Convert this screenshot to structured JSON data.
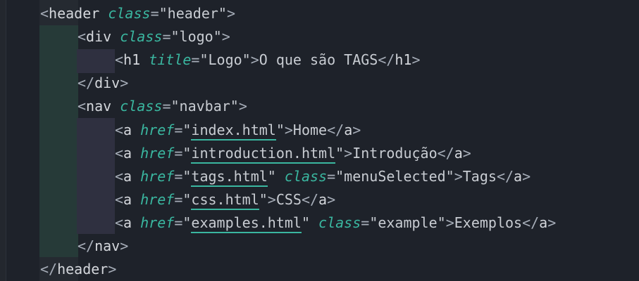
{
  "lines": [
    {
      "indent": 1,
      "parts": [
        {
          "t": "<",
          "c": "punct"
        },
        {
          "t": "header",
          "c": "tag"
        },
        {
          "t": " ",
          "c": "txt"
        },
        {
          "t": "class",
          "c": "attr"
        },
        {
          "t": "=",
          "c": "punct"
        },
        {
          "t": "\"header\"",
          "c": "str"
        },
        {
          "t": ">",
          "c": "punct"
        }
      ]
    },
    {
      "indent": 2,
      "parts": [
        {
          "t": "<",
          "c": "punct"
        },
        {
          "t": "div",
          "c": "tag"
        },
        {
          "t": " ",
          "c": "txt"
        },
        {
          "t": "class",
          "c": "attr"
        },
        {
          "t": "=",
          "c": "punct"
        },
        {
          "t": "\"logo\"",
          "c": "str"
        },
        {
          "t": ">",
          "c": "punct"
        }
      ]
    },
    {
      "indent": 3,
      "parts": [
        {
          "t": "<",
          "c": "punct"
        },
        {
          "t": "h1",
          "c": "tag"
        },
        {
          "t": " ",
          "c": "txt"
        },
        {
          "t": "title",
          "c": "attr"
        },
        {
          "t": "=",
          "c": "punct"
        },
        {
          "t": "\"Logo\"",
          "c": "str"
        },
        {
          "t": ">",
          "c": "punct"
        },
        {
          "t": "O que são TAGS",
          "c": "txt"
        },
        {
          "t": "</",
          "c": "punct"
        },
        {
          "t": "h1",
          "c": "tag"
        },
        {
          "t": ">",
          "c": "punct"
        }
      ]
    },
    {
      "indent": 2,
      "parts": [
        {
          "t": "</",
          "c": "punct"
        },
        {
          "t": "div",
          "c": "tag"
        },
        {
          "t": ">",
          "c": "punct"
        }
      ]
    },
    {
      "indent": 2,
      "parts": [
        {
          "t": "<",
          "c": "punct"
        },
        {
          "t": "nav",
          "c": "tag"
        },
        {
          "t": " ",
          "c": "txt"
        },
        {
          "t": "class",
          "c": "attr"
        },
        {
          "t": "=",
          "c": "punct"
        },
        {
          "t": "\"navbar\"",
          "c": "str"
        },
        {
          "t": ">",
          "c": "punct"
        }
      ]
    },
    {
      "indent": 3,
      "parts": [
        {
          "t": "<",
          "c": "punct"
        },
        {
          "t": "a",
          "c": "tag"
        },
        {
          "t": " ",
          "c": "txt"
        },
        {
          "t": "href",
          "c": "attr"
        },
        {
          "t": "=",
          "c": "punct"
        },
        {
          "t": "\"",
          "c": "str"
        },
        {
          "t": "index.html",
          "c": "link"
        },
        {
          "t": "\"",
          "c": "str"
        },
        {
          "t": ">",
          "c": "punct"
        },
        {
          "t": "Home",
          "c": "txt"
        },
        {
          "t": "</",
          "c": "punct"
        },
        {
          "t": "a",
          "c": "tag"
        },
        {
          "t": ">",
          "c": "punct"
        }
      ]
    },
    {
      "indent": 3,
      "parts": [
        {
          "t": "<",
          "c": "punct"
        },
        {
          "t": "a",
          "c": "tag"
        },
        {
          "t": " ",
          "c": "txt"
        },
        {
          "t": "href",
          "c": "attr"
        },
        {
          "t": "=",
          "c": "punct"
        },
        {
          "t": "\"",
          "c": "str"
        },
        {
          "t": "introduction.html",
          "c": "link"
        },
        {
          "t": "\"",
          "c": "str"
        },
        {
          "t": ">",
          "c": "punct"
        },
        {
          "t": "Introdução",
          "c": "txt"
        },
        {
          "t": "</",
          "c": "punct"
        },
        {
          "t": "a",
          "c": "tag"
        },
        {
          "t": ">",
          "c": "punct"
        }
      ]
    },
    {
      "indent": 3,
      "parts": [
        {
          "t": "<",
          "c": "punct"
        },
        {
          "t": "a",
          "c": "tag"
        },
        {
          "t": " ",
          "c": "txt"
        },
        {
          "t": "href",
          "c": "attr"
        },
        {
          "t": "=",
          "c": "punct"
        },
        {
          "t": "\"",
          "c": "str"
        },
        {
          "t": "tags.html",
          "c": "link"
        },
        {
          "t": "\"",
          "c": "str"
        },
        {
          "t": " ",
          "c": "txt"
        },
        {
          "t": "class",
          "c": "attr"
        },
        {
          "t": "=",
          "c": "punct"
        },
        {
          "t": "\"menuSelected\"",
          "c": "str"
        },
        {
          "t": ">",
          "c": "punct"
        },
        {
          "t": "Tags",
          "c": "txt"
        },
        {
          "t": "</",
          "c": "punct"
        },
        {
          "t": "a",
          "c": "tag"
        },
        {
          "t": ">",
          "c": "punct"
        }
      ]
    },
    {
      "indent": 3,
      "parts": [
        {
          "t": "<",
          "c": "punct"
        },
        {
          "t": "a",
          "c": "tag"
        },
        {
          "t": " ",
          "c": "txt"
        },
        {
          "t": "href",
          "c": "attr"
        },
        {
          "t": "=",
          "c": "punct"
        },
        {
          "t": "\"",
          "c": "str"
        },
        {
          "t": "css.html",
          "c": "link"
        },
        {
          "t": "\"",
          "c": "str"
        },
        {
          "t": ">",
          "c": "punct"
        },
        {
          "t": "CSS",
          "c": "txt"
        },
        {
          "t": "</",
          "c": "punct"
        },
        {
          "t": "a",
          "c": "tag"
        },
        {
          "t": ">",
          "c": "punct"
        }
      ]
    },
    {
      "indent": 3,
      "parts": [
        {
          "t": "<",
          "c": "punct"
        },
        {
          "t": "a",
          "c": "tag"
        },
        {
          "t": " ",
          "c": "txt"
        },
        {
          "t": "href",
          "c": "attr"
        },
        {
          "t": "=",
          "c": "punct"
        },
        {
          "t": "\"",
          "c": "str"
        },
        {
          "t": "examples.html",
          "c": "link"
        },
        {
          "t": "\"",
          "c": "str"
        },
        {
          "t": " ",
          "c": "txt"
        },
        {
          "t": "class",
          "c": "attr"
        },
        {
          "t": "=",
          "c": "punct"
        },
        {
          "t": "\"example\"",
          "c": "str"
        },
        {
          "t": ">",
          "c": "punct"
        },
        {
          "t": "Exemplos",
          "c": "txt"
        },
        {
          "t": "</",
          "c": "punct"
        },
        {
          "t": "a",
          "c": "tag"
        },
        {
          "t": ">",
          "c": "punct"
        }
      ]
    },
    {
      "indent": 2,
      "parts": [
        {
          "t": "</",
          "c": "punct"
        },
        {
          "t": "nav",
          "c": "tag"
        },
        {
          "t": ">",
          "c": "punct"
        }
      ]
    },
    {
      "indent": 1,
      "parts": [
        {
          "t": "</",
          "c": "punct"
        },
        {
          "t": "header",
          "c": "tag"
        },
        {
          "t": ">",
          "c": "punct"
        }
      ]
    }
  ],
  "colors": {
    "background": "#1e222a",
    "tag": "#d4d7dc",
    "attribute": "#3ab7a0",
    "string": "#c8ccd2",
    "link_underline": "#3ab7a0"
  }
}
